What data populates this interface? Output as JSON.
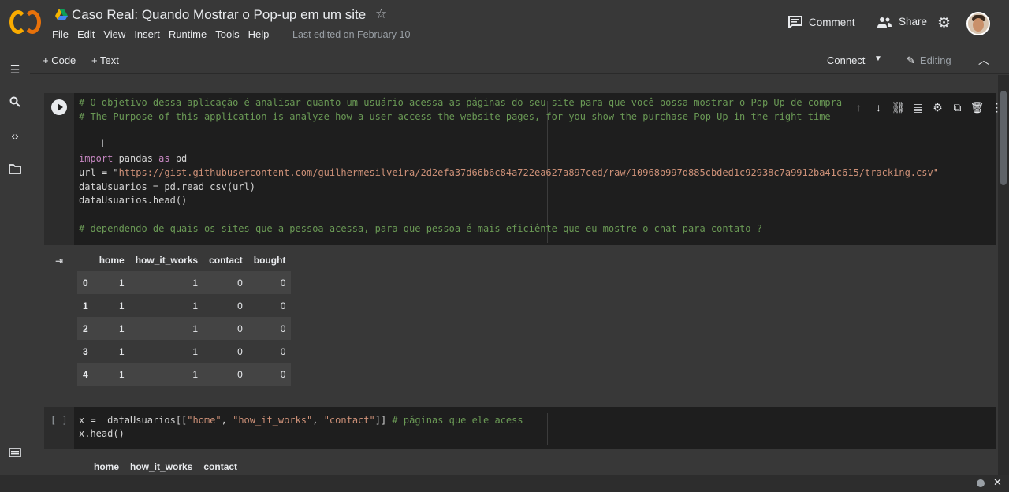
{
  "header": {
    "title": "Caso Real: Quando Mostrar o Pop-up em um site",
    "menu": [
      "File",
      "Edit",
      "View",
      "Insert",
      "Runtime",
      "Tools",
      "Help"
    ],
    "last_edited": "Last edited on February 10",
    "comment_label": "Comment",
    "share_label": "Share"
  },
  "toolbar": {
    "add_code": "+ Code",
    "add_text": "+ Text",
    "connect": "Connect",
    "editing": "Editing"
  },
  "cell1": {
    "comment_pt": "# O objetivo dessa aplicação é analisar quanto um usuário acessa as páginas do seu site para que você possa mostrar o Pop-Up de compra",
    "comment_en": "# The Purpose of this application is analyze how a user access the website pages, for you show the purchase Pop-Up in the right time",
    "import_kw": "import",
    "import_rest": " pandas ",
    "as_kw": "as",
    "as_rest": " pd",
    "url_prefix": "url = \"",
    "url_value": "https://gist.githubusercontent.com/guilhermesilveira/2d2efa37d66b6c84a722ea627a897ced/raw/10968b997d885cbded1c92938c7a9912ba41c615/tracking.csv",
    "url_suffix": "\"",
    "line_read": "dataUsuarios = pd.read_csv(url)",
    "line_head": "dataUsuarios.head()",
    "comment_chat": "# dependendo de quais os sites que a pessoa acessa, para que pessoa é mais eficiênte que eu mostre o chat para contato ?"
  },
  "output1": {
    "columns": [
      "home",
      "how_it_works",
      "contact",
      "bought"
    ],
    "rows": [
      {
        "index": "0",
        "values": [
          "1",
          "1",
          "0",
          "0"
        ]
      },
      {
        "index": "1",
        "values": [
          "1",
          "1",
          "0",
          "0"
        ]
      },
      {
        "index": "2",
        "values": [
          "1",
          "1",
          "0",
          "0"
        ]
      },
      {
        "index": "3",
        "values": [
          "1",
          "1",
          "0",
          "0"
        ]
      },
      {
        "index": "4",
        "values": [
          "1",
          "1",
          "0",
          "0"
        ]
      }
    ]
  },
  "cell2": {
    "prompt": "[ ]",
    "line1_a": "x =  dataUsuarios[[",
    "line1_s1": "\"home\"",
    "line1_c1": ", ",
    "line1_s2": "\"how_it_works\"",
    "line1_c2": ", ",
    "line1_s3": "\"contact\"",
    "line1_b": "]] ",
    "line1_cmt": "# páginas que ele acess",
    "line2": "x.head()"
  },
  "output2": {
    "columns": [
      "home",
      "how_it_works",
      "contact"
    ]
  },
  "icons": [
    "colab-logo",
    "drive-icon",
    "star-icon",
    "comment-icon",
    "share-icon",
    "gear-icon",
    "avatar",
    "toc-icon",
    "search-icon",
    "code-snippets-icon",
    "files-icon",
    "terminal-icon"
  ]
}
